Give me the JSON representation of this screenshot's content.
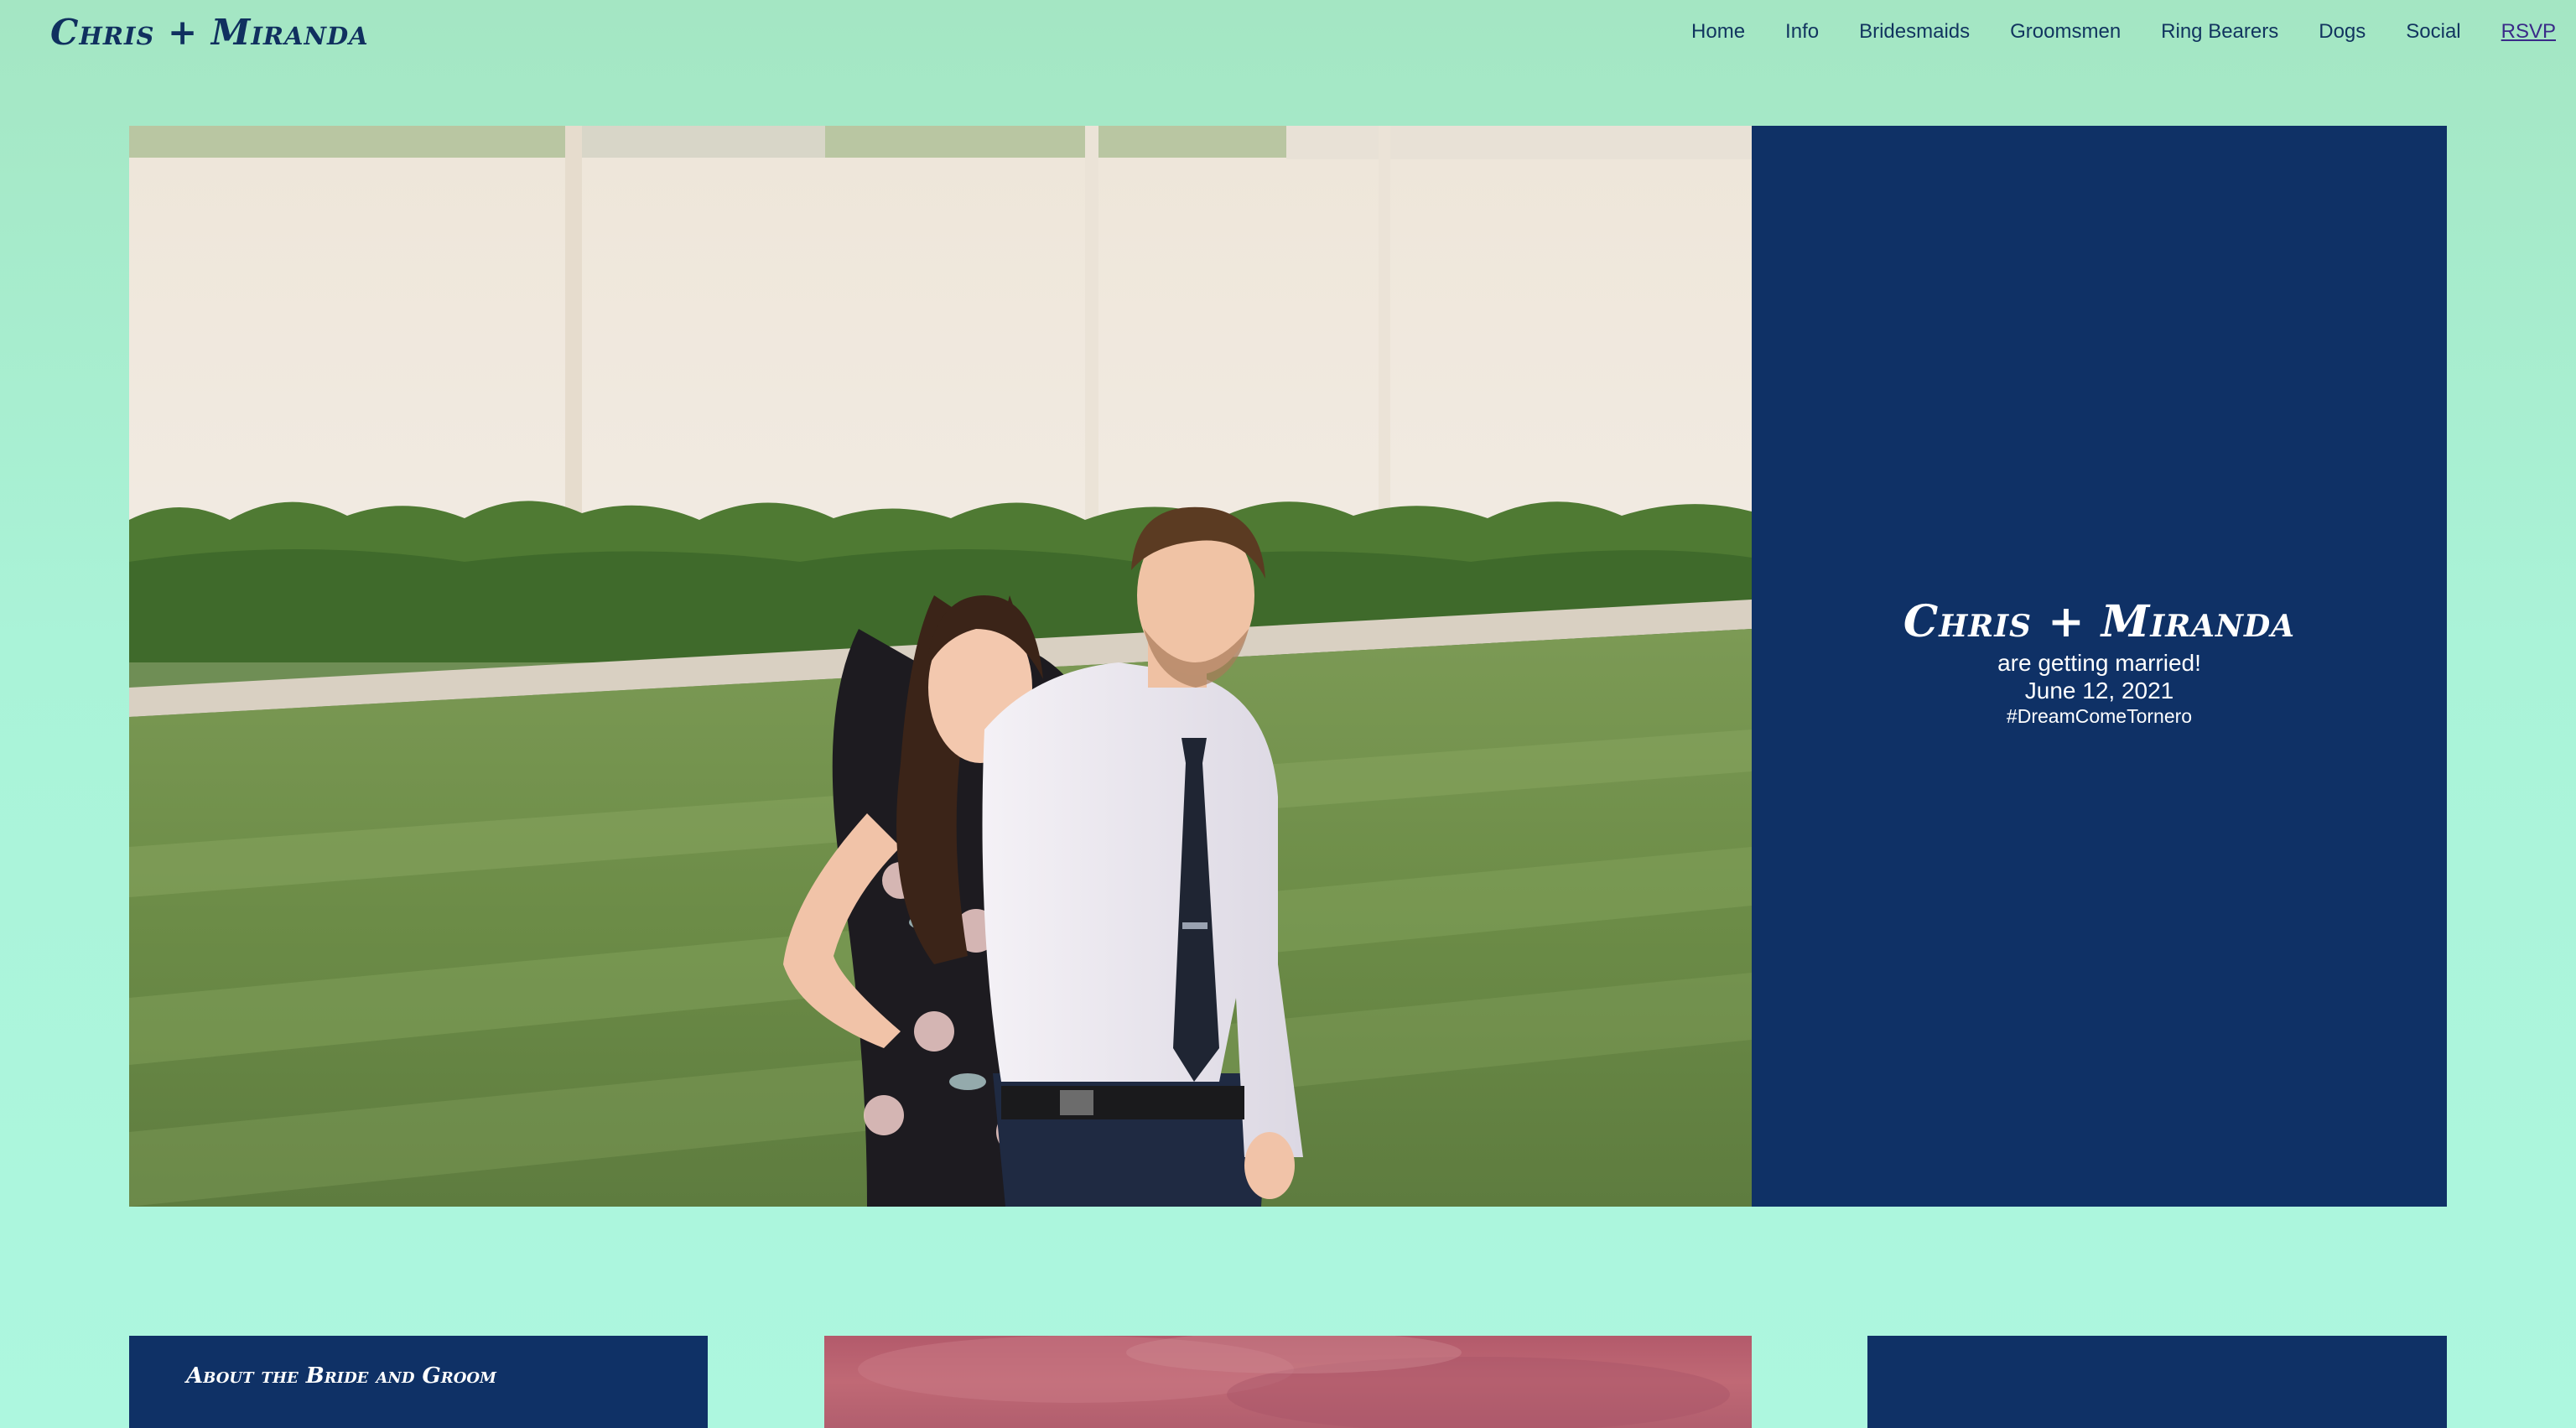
{
  "header": {
    "brand": "Chris + Miranda",
    "nav": [
      {
        "label": "Home"
      },
      {
        "label": "Info"
      },
      {
        "label": "Bridesmaids"
      },
      {
        "label": "Groomsmen"
      },
      {
        "label": "Ring Bearers"
      },
      {
        "label": "Dogs"
      },
      {
        "label": "Social"
      },
      {
        "label": "RSVP"
      }
    ]
  },
  "hero": {
    "title": "Chris + Miranda",
    "line1": "are getting married!",
    "date": "June 12, 2021",
    "hashtag": "#DreamComeTornero"
  },
  "sections": {
    "about_title": "About the Bride and Groom"
  },
  "colors": {
    "background_top": "#a4e6c3",
    "background_bottom": "#adf7df",
    "navy": "#0f3166",
    "nav_text": "#11345f"
  }
}
